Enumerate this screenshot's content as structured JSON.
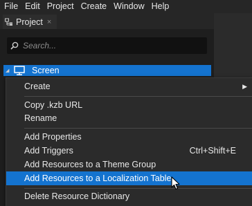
{
  "menubar": {
    "items": [
      {
        "label": "File"
      },
      {
        "label": "Edit"
      },
      {
        "label": "Project"
      },
      {
        "label": "Create"
      },
      {
        "label": "Window"
      },
      {
        "label": "Help"
      }
    ]
  },
  "panel": {
    "tab": {
      "label": "Project",
      "close": "×",
      "icon": "project-panel-icon"
    },
    "search": {
      "placeholder": "Search...",
      "value": "",
      "icon": "search-icon"
    },
    "tree": {
      "label": "Screen",
      "expanded": true,
      "icon": "screen-monitor-icon"
    }
  },
  "context_menu": {
    "create": {
      "label": "Create",
      "arrow": "▶"
    },
    "copy_url": {
      "label": "Copy .kzb URL"
    },
    "rename": {
      "label": "Rename"
    },
    "add_properties": {
      "label": "Add Properties"
    },
    "add_triggers": {
      "label": "Add Triggers",
      "shortcut": "Ctrl+Shift+E"
    },
    "add_theme": {
      "label": "Add Resources to a Theme Group"
    },
    "add_localization": {
      "label": "Add Resources to a Localization Table"
    },
    "delete_dictionary": {
      "label": "Delete Resource Dictionary"
    }
  },
  "colors": {
    "accent": "#1473cf",
    "background": "#1e1e1e",
    "menu_background": "#2b2b2b"
  }
}
